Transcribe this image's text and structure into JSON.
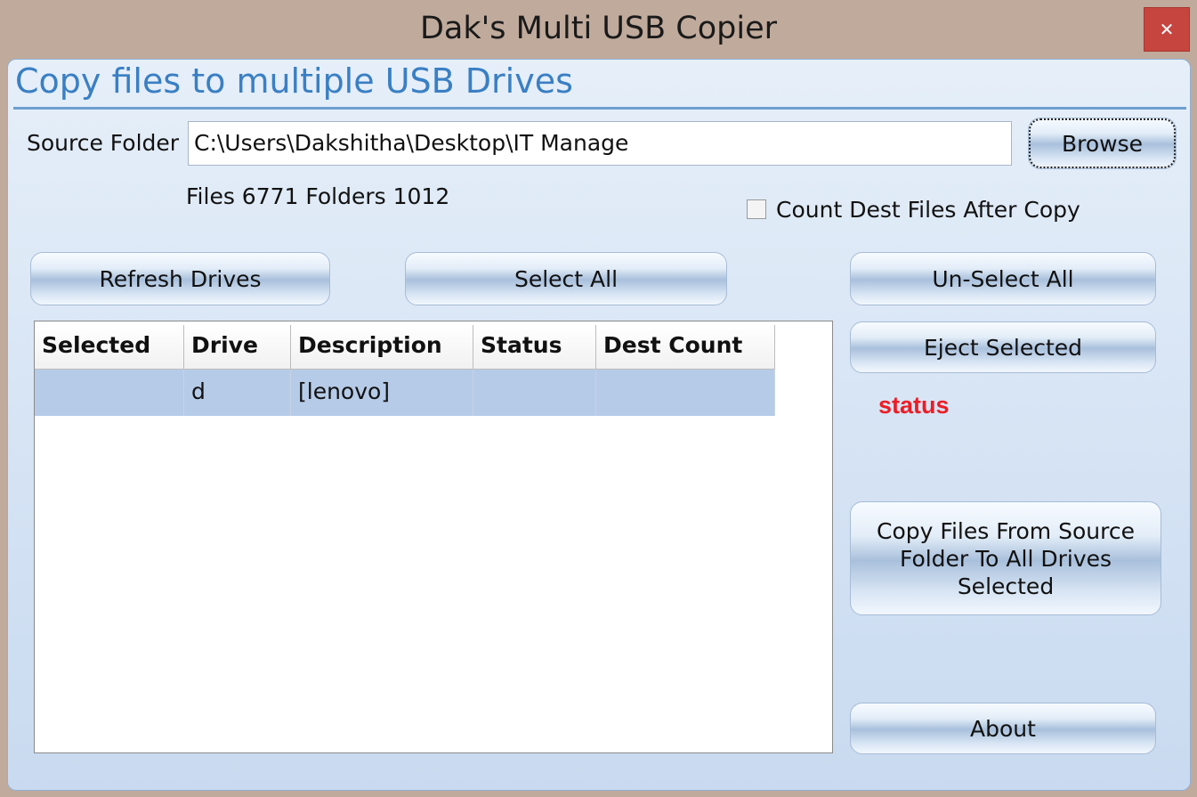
{
  "window": {
    "title": "Dak's Multi USB Copier",
    "close_glyph": "✕"
  },
  "header": {
    "title": "Copy files to multiple USB Drives"
  },
  "source": {
    "label": "Source Folder",
    "value": "C:\\Users\\Dakshitha\\Desktop\\IT Manage",
    "browse_label": "Browse",
    "counts": "Files 6771 Folders 1012"
  },
  "options": {
    "count_dest_label": "Count Dest Files After Copy",
    "count_dest_checked": false
  },
  "buttons": {
    "refresh": "Refresh Drives",
    "select_all": "Select All",
    "unselect_all": "Un-Select All",
    "eject": "Eject Selected",
    "copy": "Copy Files From Source Folder To All Drives Selected",
    "about": "About"
  },
  "status": {
    "text": "status",
    "color": "#ee1c24"
  },
  "table": {
    "columns": [
      "Selected",
      "Drive",
      "Description",
      "Status",
      "Dest Count"
    ],
    "rows": [
      [
        "",
        "d",
        "[lenovo]",
        "",
        ""
      ]
    ]
  },
  "colors": {
    "header_accent": "#3a7fc4",
    "row_selected": "#b6cbe8",
    "close_button": "#c7453f"
  }
}
